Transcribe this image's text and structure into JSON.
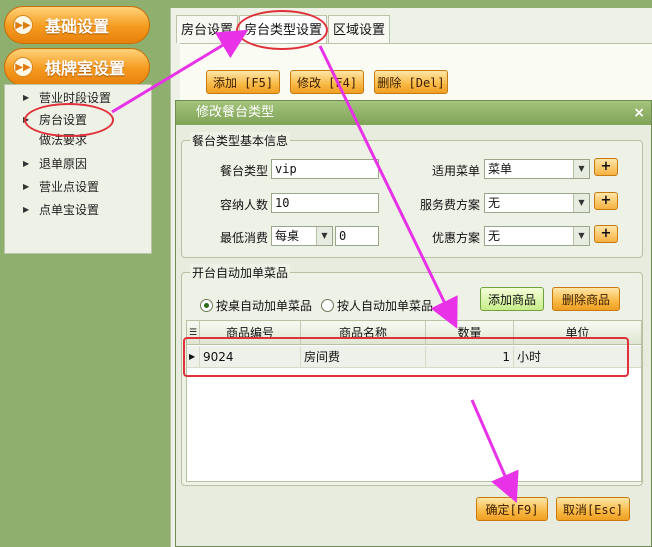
{
  "nav": {
    "header1": "基础设置",
    "header2": "棋牌室设置",
    "items": [
      "营业时段设置",
      "房台设置",
      "做法要求",
      "退单原因",
      "营业点设置",
      "点单宝设置"
    ]
  },
  "tabs": [
    "房台设置",
    "房台类型设置",
    "区域设置"
  ],
  "toolbar": {
    "add": "添加 [F5]",
    "edit": "修改 [F4]",
    "delete": "删除 [Del]"
  },
  "dialog": {
    "title": "修改餐台类型",
    "close": "×",
    "basic_group": "餐台类型基本信息",
    "labels": {
      "type": "餐台类型",
      "capacity": "容纳人数",
      "min_spend": "最低消费",
      "menu": "适用菜单",
      "service": "服务费方案",
      "discount": "优惠方案"
    },
    "values": {
      "type": "vip",
      "capacity": "10",
      "min_spend_unit": "每桌",
      "min_spend": "0",
      "menu": "菜单",
      "service": "无",
      "discount": "无"
    },
    "plus": "+",
    "auto_group": "开台自动加单菜品",
    "radio1": "按桌自动加单菜品",
    "radio2": "按人自动加单菜品",
    "add_item": "添加商品",
    "delete_item": "删除商品",
    "grid": {
      "corner": "☰",
      "headers": [
        "商品编号",
        "商品名称",
        "数量",
        "单位"
      ],
      "rows": [
        {
          "code": "9024",
          "name": "房间费",
          "qty": "1",
          "unit": "小时"
        }
      ]
    },
    "ok": "确定[F9]",
    "cancel": "取消[Esc]"
  },
  "colors": {
    "annotation_circle": "#e0313a",
    "annotation_arrow": "#e832e8",
    "accent_orange": "#f59a1e"
  }
}
